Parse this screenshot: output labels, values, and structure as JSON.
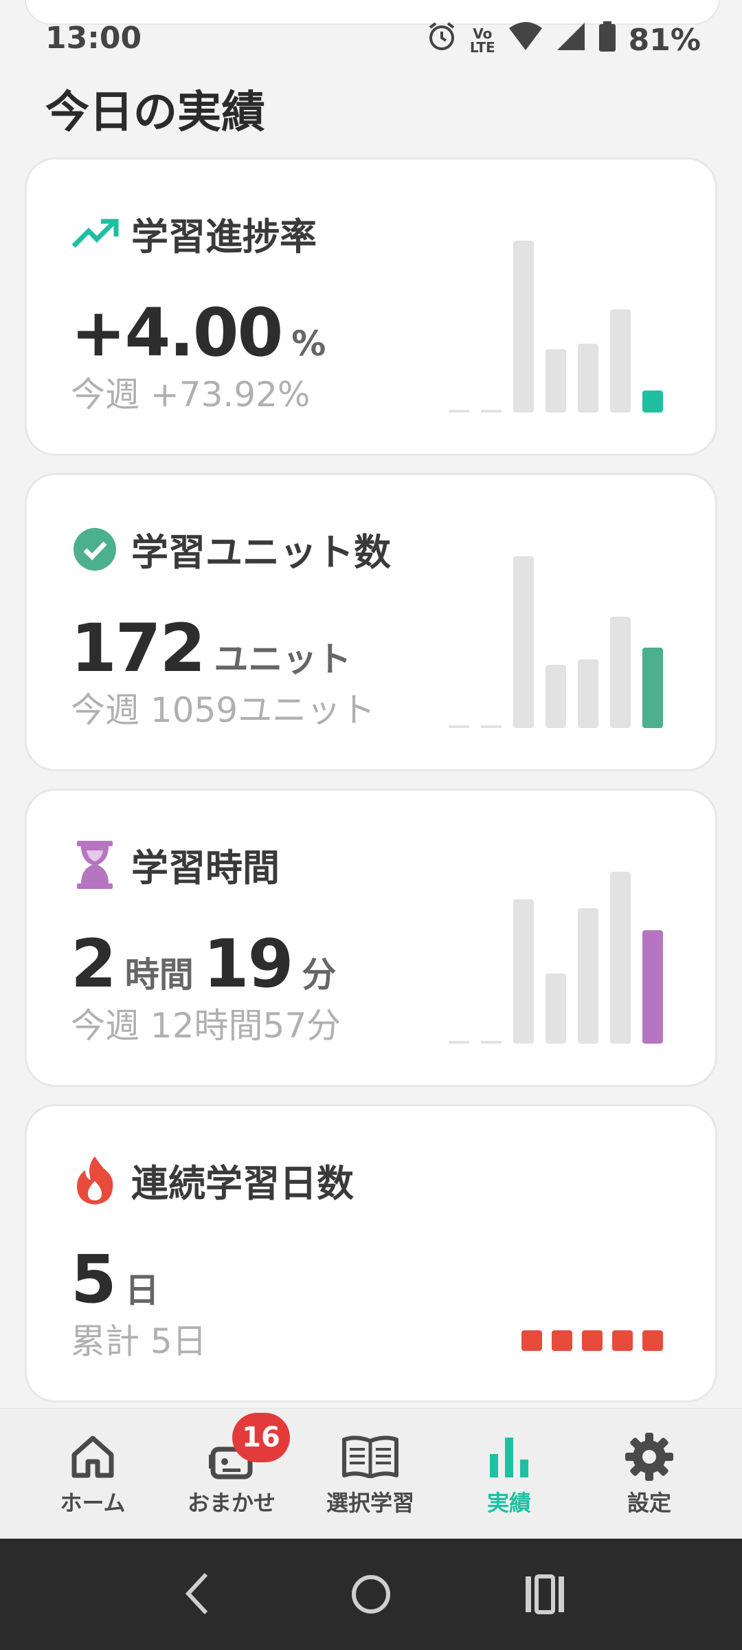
{
  "status_bar": {
    "time": "13:00",
    "battery": "81%",
    "lte_top": "Vo",
    "lte_bottom": "LTE"
  },
  "page": {
    "title": "今日の実績"
  },
  "cards": {
    "progress": {
      "title": "学習進捗率",
      "value": "+4.00",
      "unit": "%",
      "week": "今週 +73.92%",
      "icon": "trending-up-icon",
      "accent": "#1fbfa2",
      "bars": [
        0,
        0,
        1.0,
        0.37,
        0.4,
        0.6,
        0.1
      ]
    },
    "units": {
      "title": "学習ユニット数",
      "value": "172",
      "unit": "ユニット",
      "week": "今週 1059ユニット",
      "icon": "check-circle-icon",
      "accent": "#4caf8e",
      "bars": [
        0,
        0,
        1.0,
        0.37,
        0.4,
        0.65,
        0.47
      ]
    },
    "time": {
      "title": "学習時間",
      "value_h": "2",
      "unit_h": "時間",
      "value_m": "19",
      "unit_m": "分",
      "week": "今週 12時間57分",
      "icon": "hourglass-icon",
      "accent": "#b575c0",
      "bars": [
        0,
        0,
        0.84,
        0.41,
        0.79,
        1.0,
        0.66
      ]
    },
    "streak": {
      "title": "連続学習日数",
      "value": "5",
      "unit": "日",
      "total": "累計 5日",
      "icon": "fire-icon",
      "accent": "#e84b3c",
      "days": 5
    }
  },
  "bottom_nav": {
    "items": [
      {
        "label": "ホーム",
        "icon": "home-icon"
      },
      {
        "label": "おまかせ",
        "icon": "robot-icon",
        "badge": "16"
      },
      {
        "label": "選択学習",
        "icon": "book-icon"
      },
      {
        "label": "実績",
        "icon": "bar-chart-icon",
        "active": true
      },
      {
        "label": "設定",
        "icon": "gear-icon"
      }
    ]
  }
}
